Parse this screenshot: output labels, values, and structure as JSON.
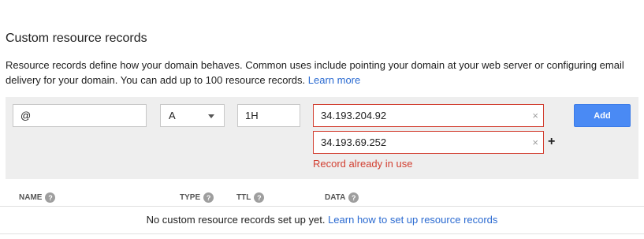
{
  "section": {
    "title": "Custom resource records",
    "description": "Resource records define how your domain behaves. Common uses include pointing your domain at your web server or configuring email delivery for your domain. You can add up to 100 resource records.",
    "learn_more": "Learn more"
  },
  "form": {
    "name_value": "@",
    "type_value": "A",
    "ttl_value": "1H",
    "data_values": [
      "34.193.204.92",
      "34.193.69.252"
    ],
    "clear_glyph": "×",
    "add_row_glyph": "+",
    "error": "Record already in use",
    "add_label": "Add"
  },
  "table": {
    "headers": [
      "NAME",
      "TYPE",
      "TTL",
      "DATA"
    ],
    "help_glyph": "?",
    "empty_text": "No custom resource records set up yet.",
    "empty_link": "Learn how to set up resource records"
  },
  "colors": {
    "accent": "#4a8af4",
    "error": "#d23f31",
    "link": "#2a6ad1",
    "panel": "#eeeeee"
  }
}
